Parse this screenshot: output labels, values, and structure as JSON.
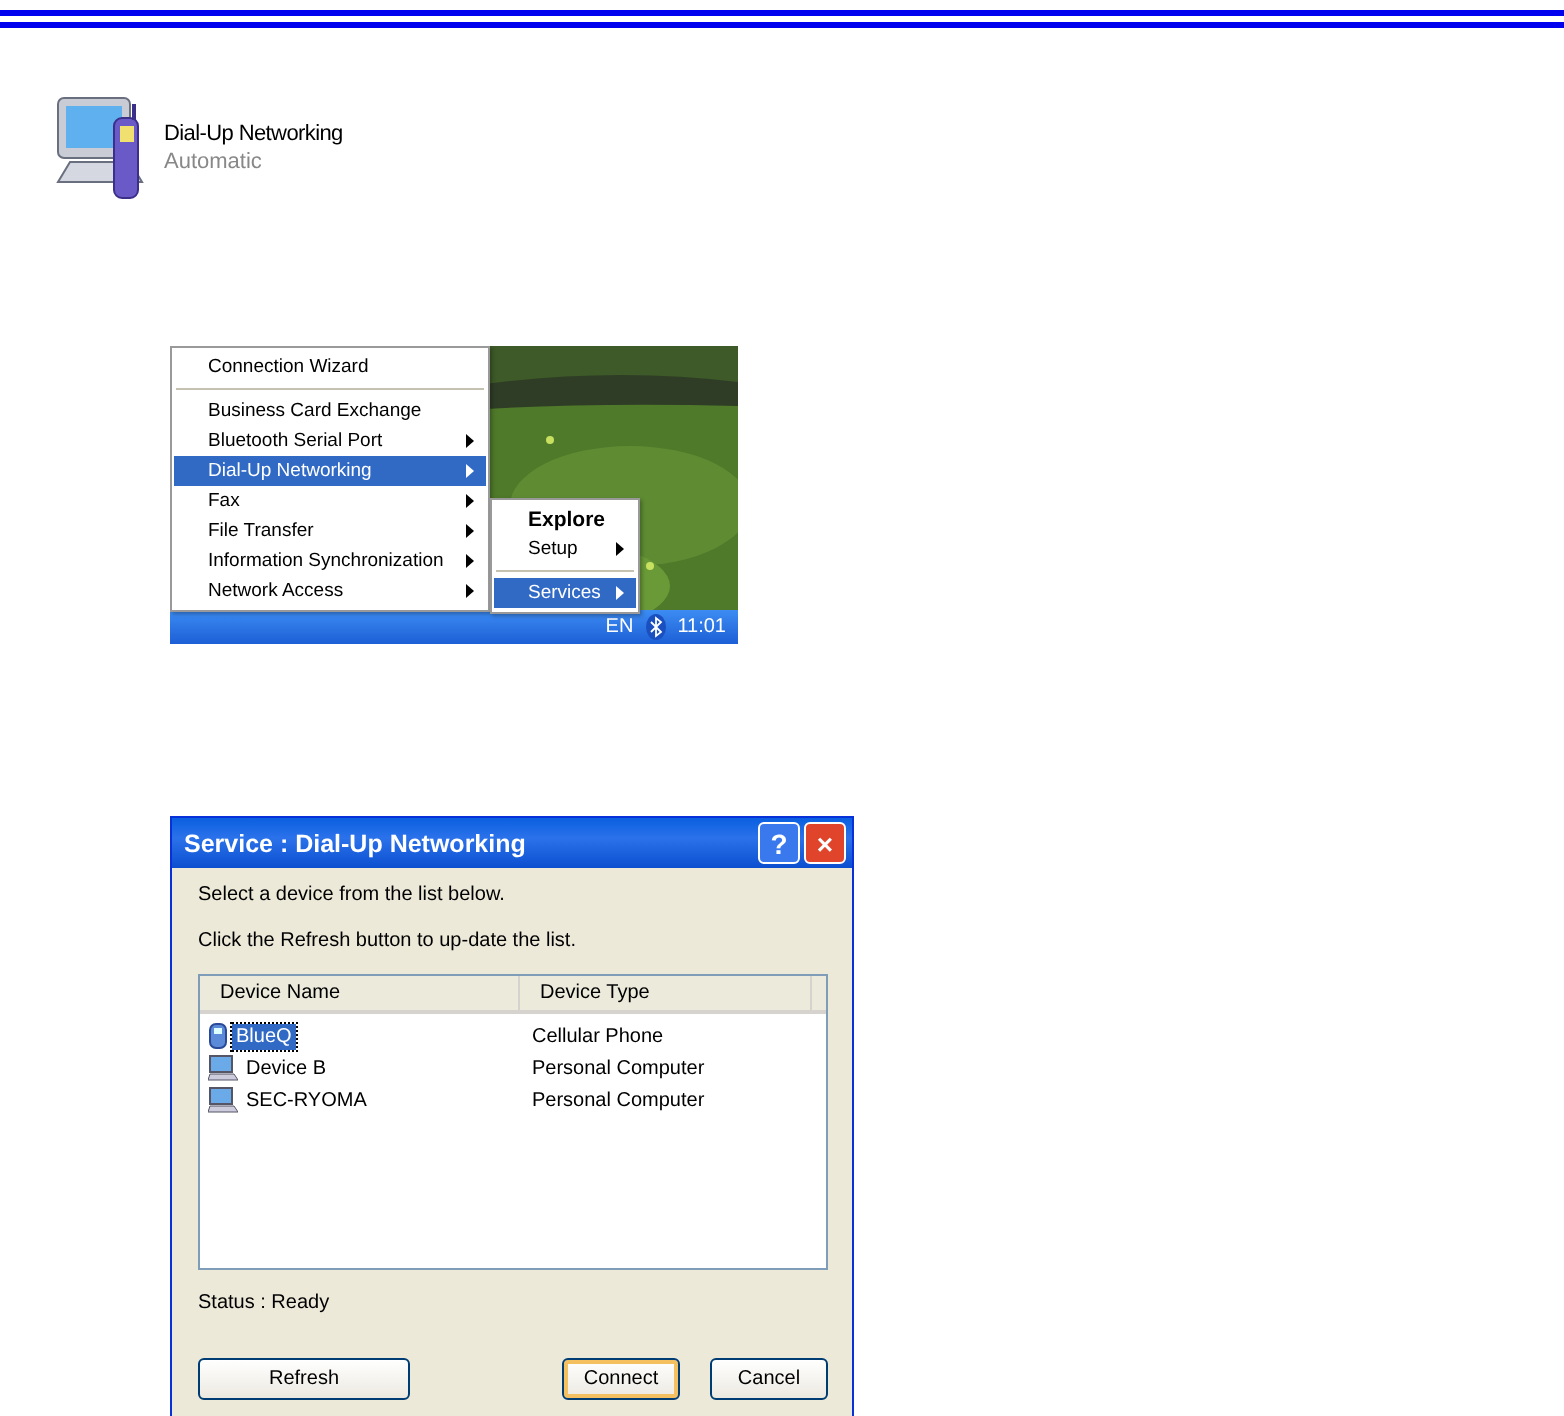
{
  "service_icon": {
    "title": "Dial-Up Networking",
    "subtitle": "Automatic"
  },
  "taskbar_menu": {
    "items": [
      {
        "kind": "item",
        "label": "Connection Wizard",
        "submenu": false,
        "selected": false
      },
      {
        "kind": "separator"
      },
      {
        "kind": "item",
        "label": "Business Card Exchange",
        "submenu": false,
        "selected": false
      },
      {
        "kind": "item",
        "label": "Bluetooth Serial Port",
        "submenu": true,
        "selected": false
      },
      {
        "kind": "item",
        "label": "Dial-Up Networking",
        "submenu": true,
        "selected": true
      },
      {
        "kind": "item",
        "label": "Fax",
        "submenu": true,
        "selected": false
      },
      {
        "kind": "item",
        "label": "File Transfer",
        "submenu": true,
        "selected": false
      },
      {
        "kind": "item",
        "label": "Information Synchronization",
        "submenu": true,
        "selected": false
      },
      {
        "kind": "item",
        "label": "Network Access",
        "submenu": true,
        "selected": false
      }
    ],
    "submenu": [
      {
        "kind": "default",
        "label": "Explore",
        "submenu": false,
        "selected": false
      },
      {
        "kind": "item",
        "label": "Setup",
        "submenu": true,
        "selected": false
      },
      {
        "kind": "separator"
      },
      {
        "kind": "item",
        "label": "Services",
        "submenu": true,
        "selected": true
      }
    ],
    "tray": {
      "language": "EN",
      "clock": "11:01"
    }
  },
  "dialog": {
    "title": "Service : Dial-Up Networking",
    "help": "?",
    "close": "×",
    "instructions": [
      "Select a device from the list below.",
      "Click the Refresh button to up-date the list."
    ],
    "columns": [
      "Device Name",
      "Device Type"
    ],
    "rows": [
      {
        "kind": "phone",
        "name": "BlueQ",
        "type": "Cellular Phone",
        "selected": true
      },
      {
        "kind": "computer",
        "name": "Device B",
        "type": "Personal Computer",
        "selected": false
      },
      {
        "kind": "computer",
        "name": "SEC-RYOMA",
        "type": "Personal Computer",
        "selected": false
      }
    ],
    "status": "Status : Ready",
    "buttons": [
      {
        "label": "Refresh",
        "default": false
      },
      {
        "label": "Connect",
        "default": true
      },
      {
        "label": "Cancel",
        "default": false
      }
    ]
  }
}
